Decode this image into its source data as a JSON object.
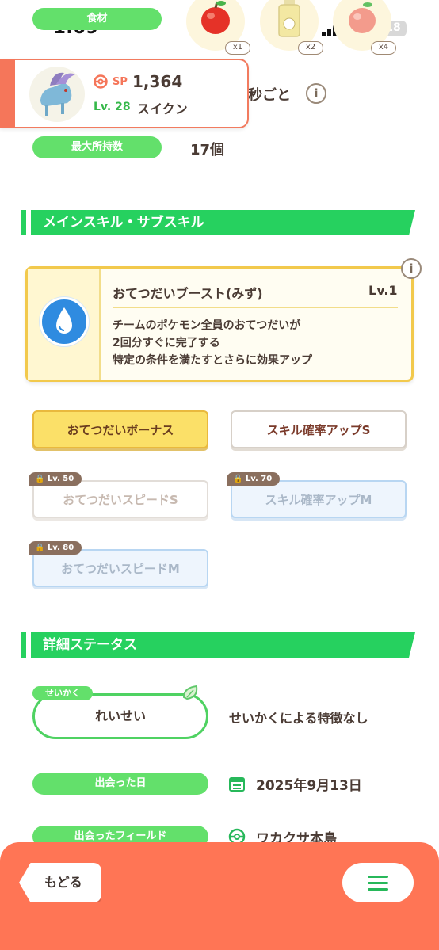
{
  "status_bar": {
    "time": "1:09",
    "battery": "18"
  },
  "ingredients": {
    "label": "食材",
    "items": [
      {
        "name": "apple-icon",
        "count": "x1"
      },
      {
        "name": "oil-icon",
        "count": "x2"
      },
      {
        "name": "peach-icon",
        "count": "x4"
      }
    ]
  },
  "pokemon": {
    "sp_label": "SP",
    "sp_value": "1,364",
    "level": "Lv. 28",
    "name": "スイクン"
  },
  "help_time": {
    "suffix": "秒ごと"
  },
  "max_carry": {
    "label": "最大所持数",
    "value": "17個"
  },
  "skills_section": {
    "title": "メインスキル・サブスキル"
  },
  "main_skill": {
    "name": "おてつだいブースト(みず)",
    "level": "Lv.1",
    "desc1": "チームのポケモン全員のおてつだいが",
    "desc2": "2回分すぐに完了する",
    "desc3": "特定の条件を満たすとさらに効果アップ",
    "info_icon": "i"
  },
  "sub_skills": [
    {
      "label": "おてつだいボーナス",
      "lock": ""
    },
    {
      "label": "スキル確率アップS",
      "lock": ""
    },
    {
      "label": "おてつだいスピードS",
      "lock": "Lv. 50"
    },
    {
      "label": "スキル確率アップM",
      "lock": "Lv. 70"
    },
    {
      "label": "おてつだいスピードM",
      "lock": "Lv. 80"
    }
  ],
  "detail_section": {
    "title": "詳細ステータス"
  },
  "nature": {
    "tag": "せいかく",
    "value": "れいせい",
    "effect": "せいかくによる特徴なし"
  },
  "met_date": {
    "label": "出会った日",
    "value": "2025年9月13日"
  },
  "met_field": {
    "label": "出会ったフィールド",
    "value": "ワカクサ本島"
  },
  "bottom": {
    "back": "もどる"
  },
  "colors": {
    "accent_green": "#26d15f",
    "pill_green": "#63e06b",
    "bottom_bar": "#ff7555",
    "skill_gold": "#f2c94c"
  }
}
